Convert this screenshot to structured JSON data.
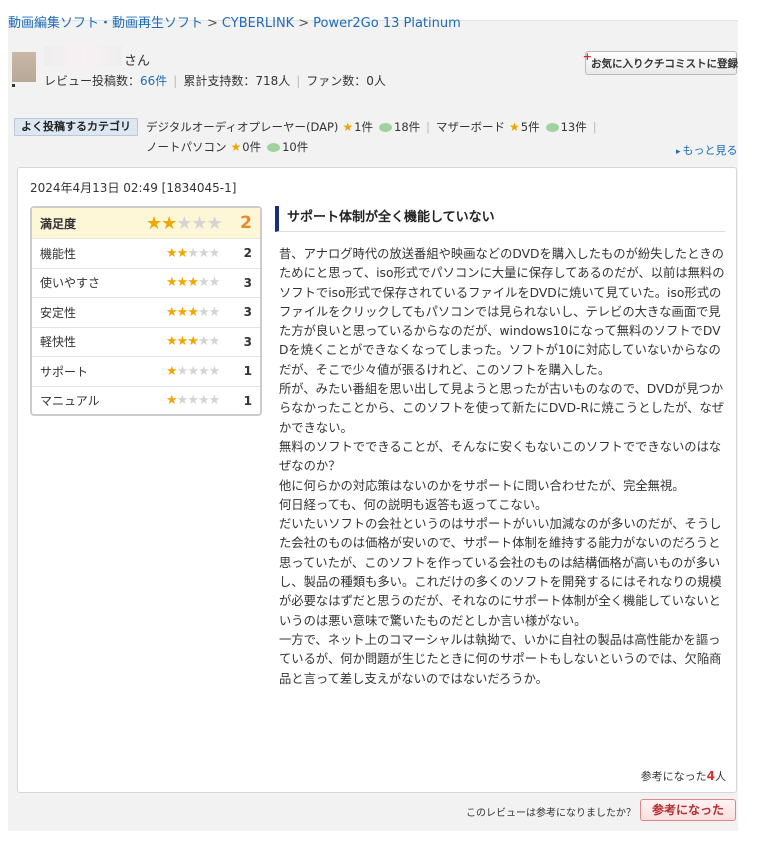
{
  "breadcrumb": {
    "items": [
      "動画編集ソフト・動画再生ソフト",
      "CYBERLINK",
      "Power2Go 13 Platinum"
    ],
    "separator": ">"
  },
  "reviewer": {
    "suffix": "さん",
    "review_count_label": "レビュー投稿数：",
    "review_count": "66件",
    "support_label": "累計支持数：718人",
    "fans_label": "ファン数：0人"
  },
  "fav_button": {
    "label": "お気に入りクチコミストに登録"
  },
  "categories": {
    "label": "よく投稿するカテゴリ",
    "items": [
      {
        "name": "デジタルオーディオプレーヤー(DAP)",
        "stars": "1件",
        "comments": "18件"
      },
      {
        "name": "マザーボード",
        "stars": "5件",
        "comments": "13件"
      },
      {
        "name": "ノートパソコン",
        "stars": "0件",
        "comments": "10件"
      }
    ],
    "more": "もっと見る"
  },
  "review": {
    "date": "2024年4月13日 02:49 [1834045-1]",
    "title": "サポート体制が全く機能していない",
    "ratings": [
      {
        "label": "満足度",
        "value": "2",
        "stars": 2
      },
      {
        "label": "機能性",
        "value": "2",
        "stars": 2
      },
      {
        "label": "使いやすさ",
        "value": "3",
        "stars": 3
      },
      {
        "label": "安定性",
        "value": "3",
        "stars": 3
      },
      {
        "label": "軽快性",
        "value": "3",
        "stars": 3
      },
      {
        "label": "サポート",
        "value": "1",
        "stars": 1
      },
      {
        "label": "マニュアル",
        "value": "1",
        "stars": 1
      }
    ],
    "paragraphs": [
      "昔、アナログ時代の放送番組や映画などのDVDを購入したものが紛失したときのためにと思って、iso形式でパソコンに大量に保存してあるのだが、以前は無料のソフトでiso形式で保存されているファイルをDVDに焼いて見ていた。iso形式のファイルをクリックしてもパソコンでは見られないし、テレビの大きな画面で見た方が良いと思っているからなのだが、windows10になって無料のソフトでDVDを焼くことができなくなってしまった。ソフトが10に対応していないからなのだが、そこで少々値が張るけれど、このソフトを購入した。",
      "所が、みたい番組を思い出して見ようと思ったが古いものなので、DVDが見つからなかったことから、このソフトを使って新たにDVD-Rに焼こうとしたが、なぜかできない。",
      "無料のソフトでできることが、そんなに安くもないこのソフトでできないのはなぜなのか？",
      "他に何らかの対応策はないのかをサポートに問い合わせたが、完全無視。",
      "何日経っても、何の説明も返答も返ってこない。",
      "だいたいソフトの会社というのはサポートがいい加減なのが多いのだが、そうした会社のものは価格が安いので、サポート体制を維持する能力がないのだろうと思っていたが、このソフトを作っている会社のものは結構価格が高いものが多いし、製品の種類も多い。これだけの多くのソフトを開発するにはそれなりの規模が必要なはずだと思うのだが、それなのにサポート体制が全く機能していないというのは悪い意味で驚いたものだとしか言い様がない。",
      "一方で、ネット上のコマーシャルは執拗で、いかに自社の製品は高性能かを謳っているが、何か問題が生じたときに何のサポートもしないというのでは、欠陥商品と言って差し支えがないのではないだろうか。"
    ],
    "helpful_prefix": "参考になった",
    "helpful_count": "4",
    "helpful_suffix": "人"
  },
  "vote": {
    "question": "このレビューは参考になりましたか？",
    "button": "参考になった"
  },
  "colors": {
    "link": "#1e6bb8",
    "star": "#f2a600",
    "accent": "#e7892b",
    "title_bar": "#1a2e7a"
  }
}
